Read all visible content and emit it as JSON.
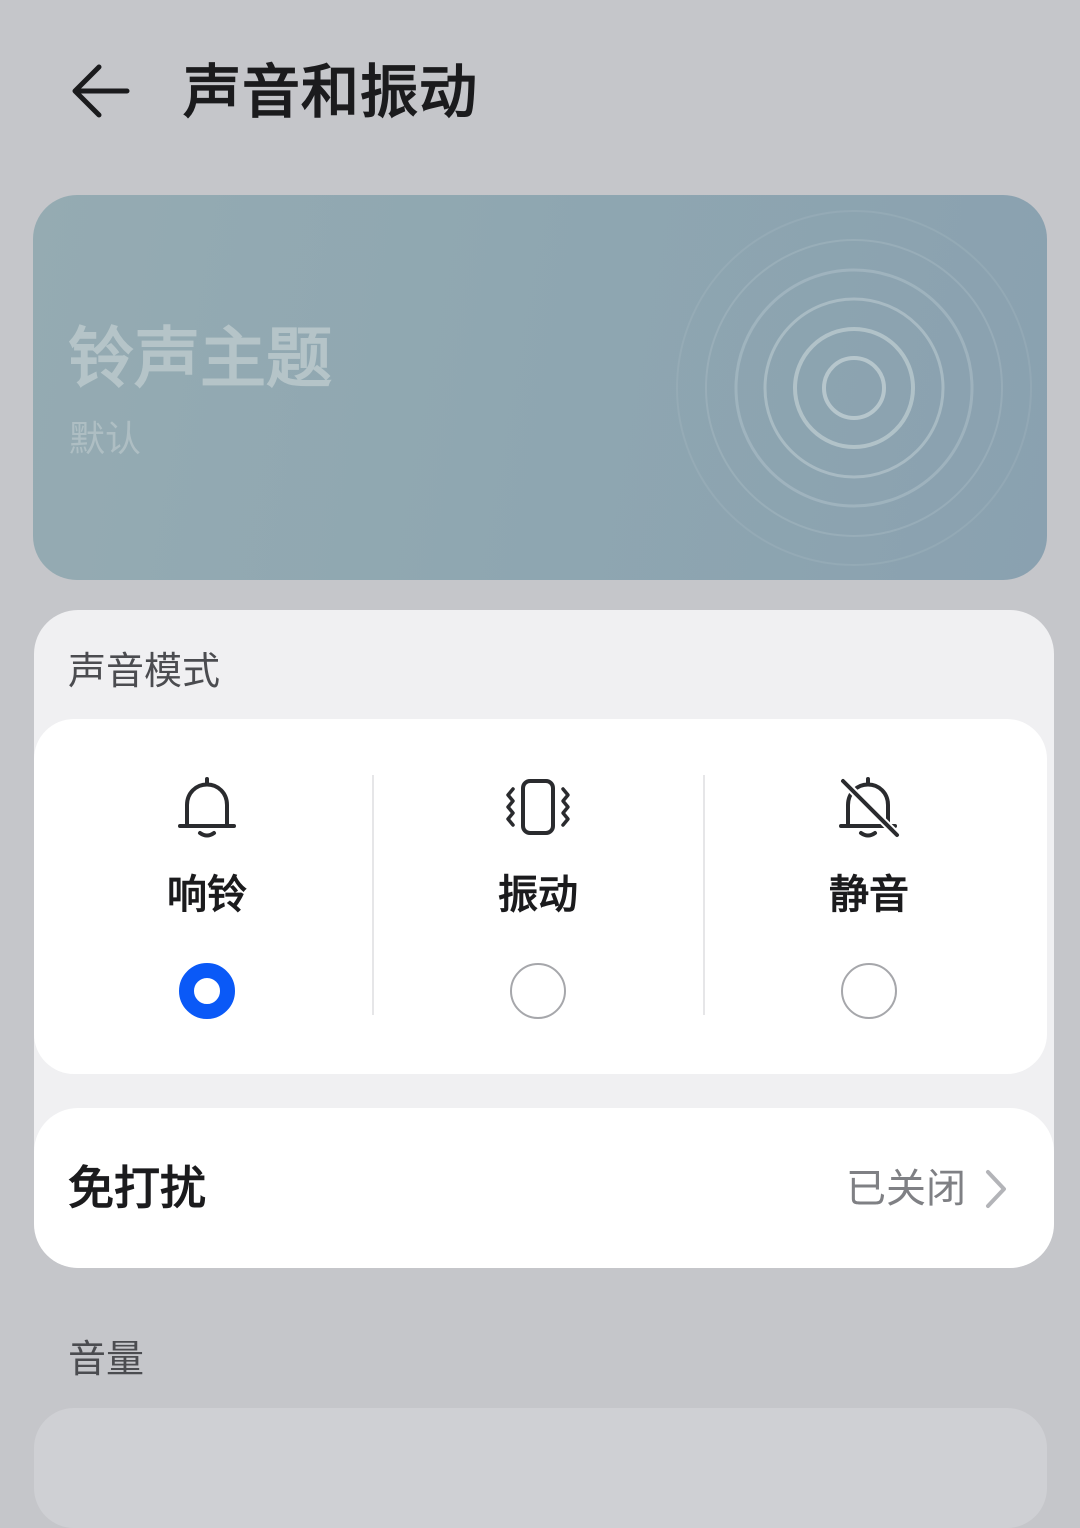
{
  "header": {
    "title": "声音和振动"
  },
  "ringtone_theme": {
    "title": "铃声主题",
    "value": "默认"
  },
  "sound_mode": {
    "section_label": "声音模式",
    "options": [
      {
        "label": "响铃",
        "icon": "bell-icon",
        "selected": true
      },
      {
        "label": "振动",
        "icon": "vibrate-icon",
        "selected": false
      },
      {
        "label": "静音",
        "icon": "bell-off-icon",
        "selected": false
      }
    ]
  },
  "do_not_disturb": {
    "label": "免打扰",
    "status": "已关闭"
  },
  "volume": {
    "section_label": "音量"
  },
  "colors": {
    "accent": "#0a59f7",
    "background": "#c5c6ca",
    "card_bg": "#ffffff",
    "panel_bg": "#f0f0f2",
    "ringtone_card": "#8fa7b1"
  }
}
